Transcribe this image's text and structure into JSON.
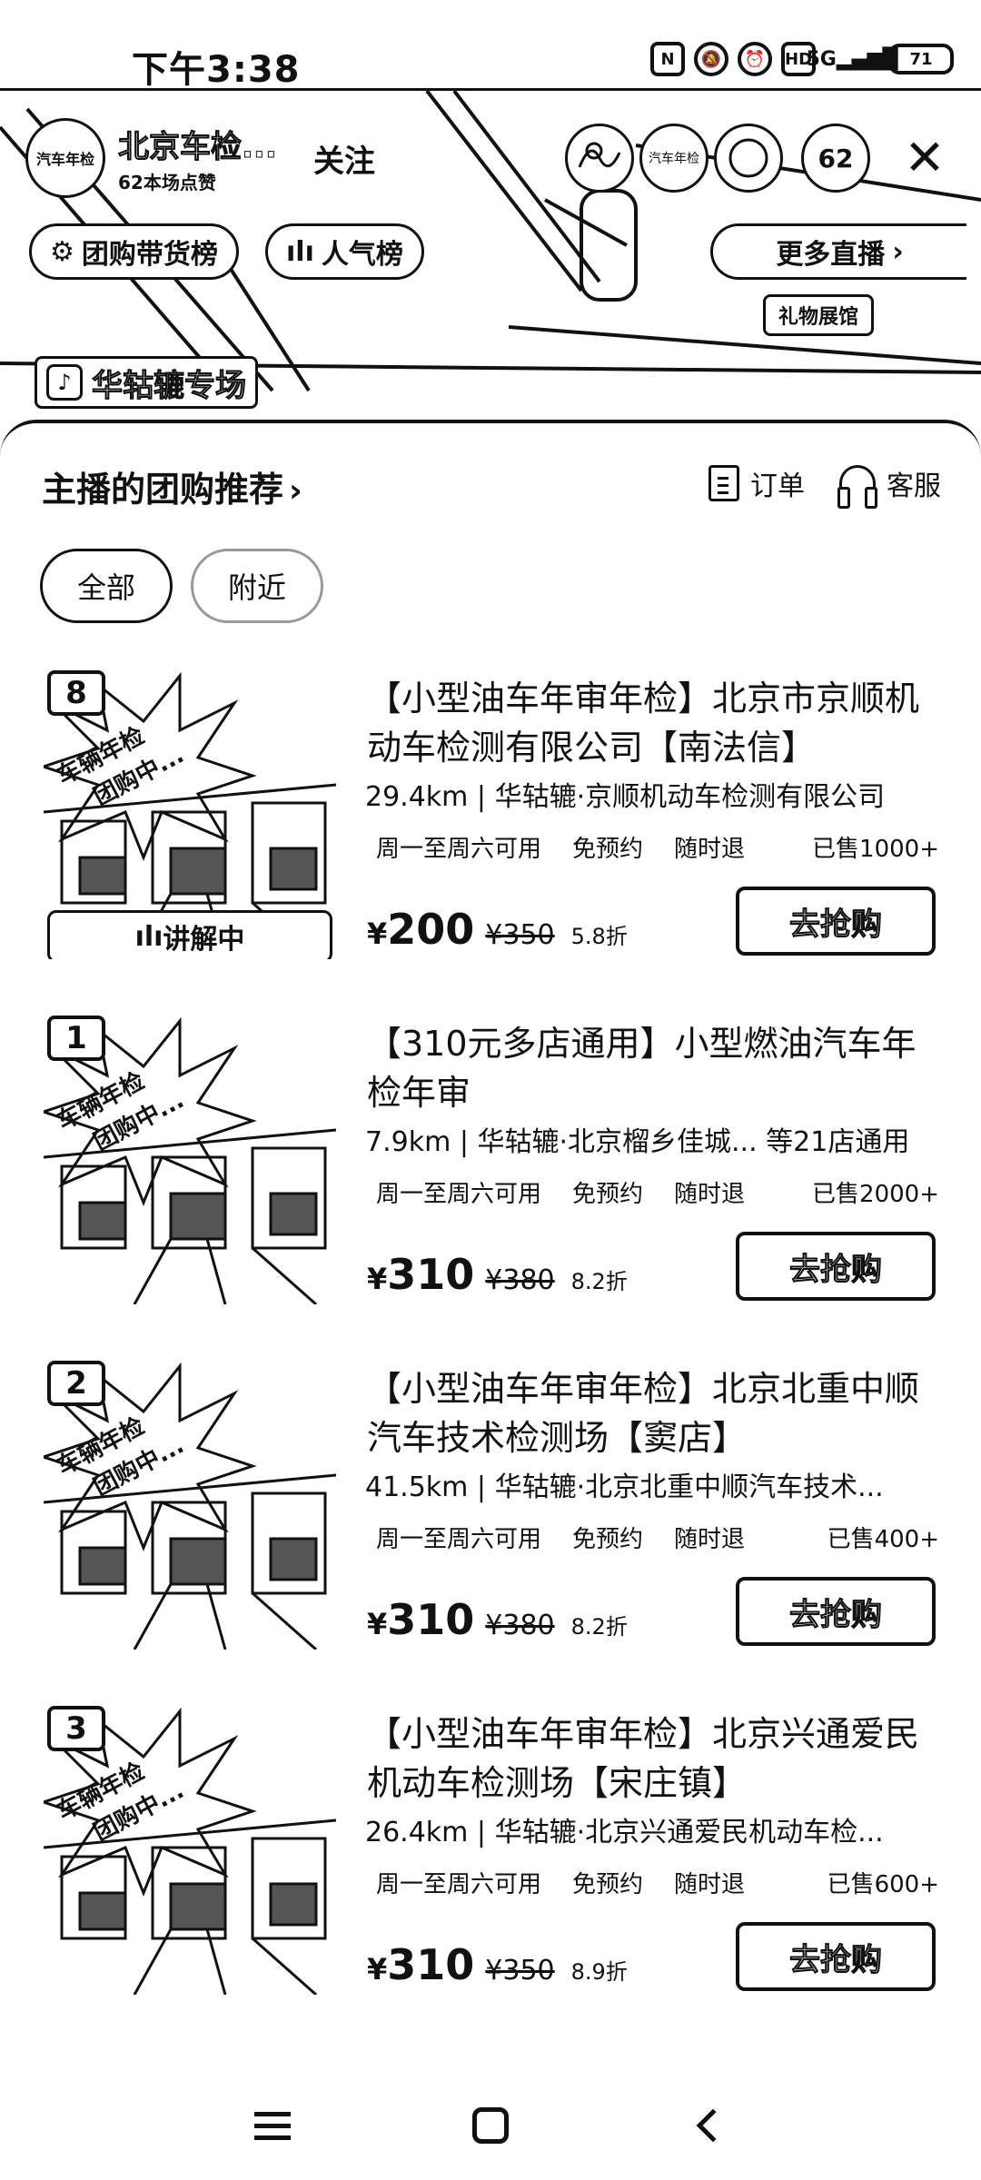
{
  "status_bar": {
    "time": "下午3:38",
    "icons": [
      "nfc-icon",
      "mute-icon",
      "alarm-icon",
      "hd-icon",
      "5g-signal-icon"
    ],
    "hd_label": "HD",
    "network_label": "5G",
    "battery": "71"
  },
  "live": {
    "anchor_name": "北京车检...",
    "anchor_avatar_text": "汽车年检",
    "anchor_sub": "62本场点赞",
    "follow_label": "关注",
    "viewer_avatar_text": "汽车年检",
    "viewer_count": "62",
    "pill_groupbuy": "团购带货榜",
    "pill_popular": "人气榜",
    "pill_more": "更多直播",
    "gift_hall": "礼物展馆",
    "store_tag": "华轱辘专场"
  },
  "sheet": {
    "title": "主播的团购推荐",
    "orders_label": "订单",
    "service_label": "客服",
    "filters": [
      "全部",
      "附近"
    ]
  },
  "products": [
    {
      "rank": "8",
      "burst_line1": "车辆年检",
      "burst_line2": "团购中...",
      "explaining": "讲解中",
      "title": "【小型油车年审年检】北京市京顺机动车检测有限公司【南法信】",
      "sub": "29.4km | 华轱辘·京顺机动车检测有限公司",
      "tags": [
        "周一至周六可用",
        "免预约",
        "随时退"
      ],
      "sold": "已售1000+",
      "price": "200",
      "original": "¥350",
      "discount": "5.8折",
      "buy_label": "去抢购"
    },
    {
      "rank": "1",
      "burst_line1": "车辆年检",
      "burst_line2": "团购中...",
      "explaining": "",
      "title": "【310元多店通用】小型燃油汽车年检年审",
      "sub": "7.9km | 华轱辘·北京榴乡佳城... 等21店通用",
      "tags": [
        "周一至周六可用",
        "免预约",
        "随时退"
      ],
      "sold": "已售2000+",
      "price": "310",
      "original": "¥380",
      "discount": "8.2折",
      "buy_label": "去抢购"
    },
    {
      "rank": "2",
      "burst_line1": "车辆年检",
      "burst_line2": "团购中...",
      "explaining": "",
      "title": "【小型油车年审年检】北京北重中顺汽车技术检测场【窦店】",
      "sub": "41.5km | 华轱辘·北京北重中顺汽车技术...",
      "tags": [
        "周一至周六可用",
        "免预约",
        "随时退"
      ],
      "sold": "已售400+",
      "price": "310",
      "original": "¥380",
      "discount": "8.2折",
      "buy_label": "去抢购"
    },
    {
      "rank": "3",
      "burst_line1": "车辆年检",
      "burst_line2": "团购中...",
      "explaining": "",
      "title": "【小型油车年审年检】北京兴通爱民机动车检测场【宋庄镇】",
      "sub": "26.4km | 华轱辘·北京兴通爱民机动车检...",
      "tags": [
        "周一至周六可用",
        "免预约",
        "随时退"
      ],
      "sold": "已售600+",
      "price": "310",
      "original": "¥350",
      "discount": "8.9折",
      "buy_label": "去抢购"
    }
  ],
  "currency_symbol": "¥",
  "nav": [
    "menu-icon",
    "home-icon",
    "back-icon"
  ]
}
